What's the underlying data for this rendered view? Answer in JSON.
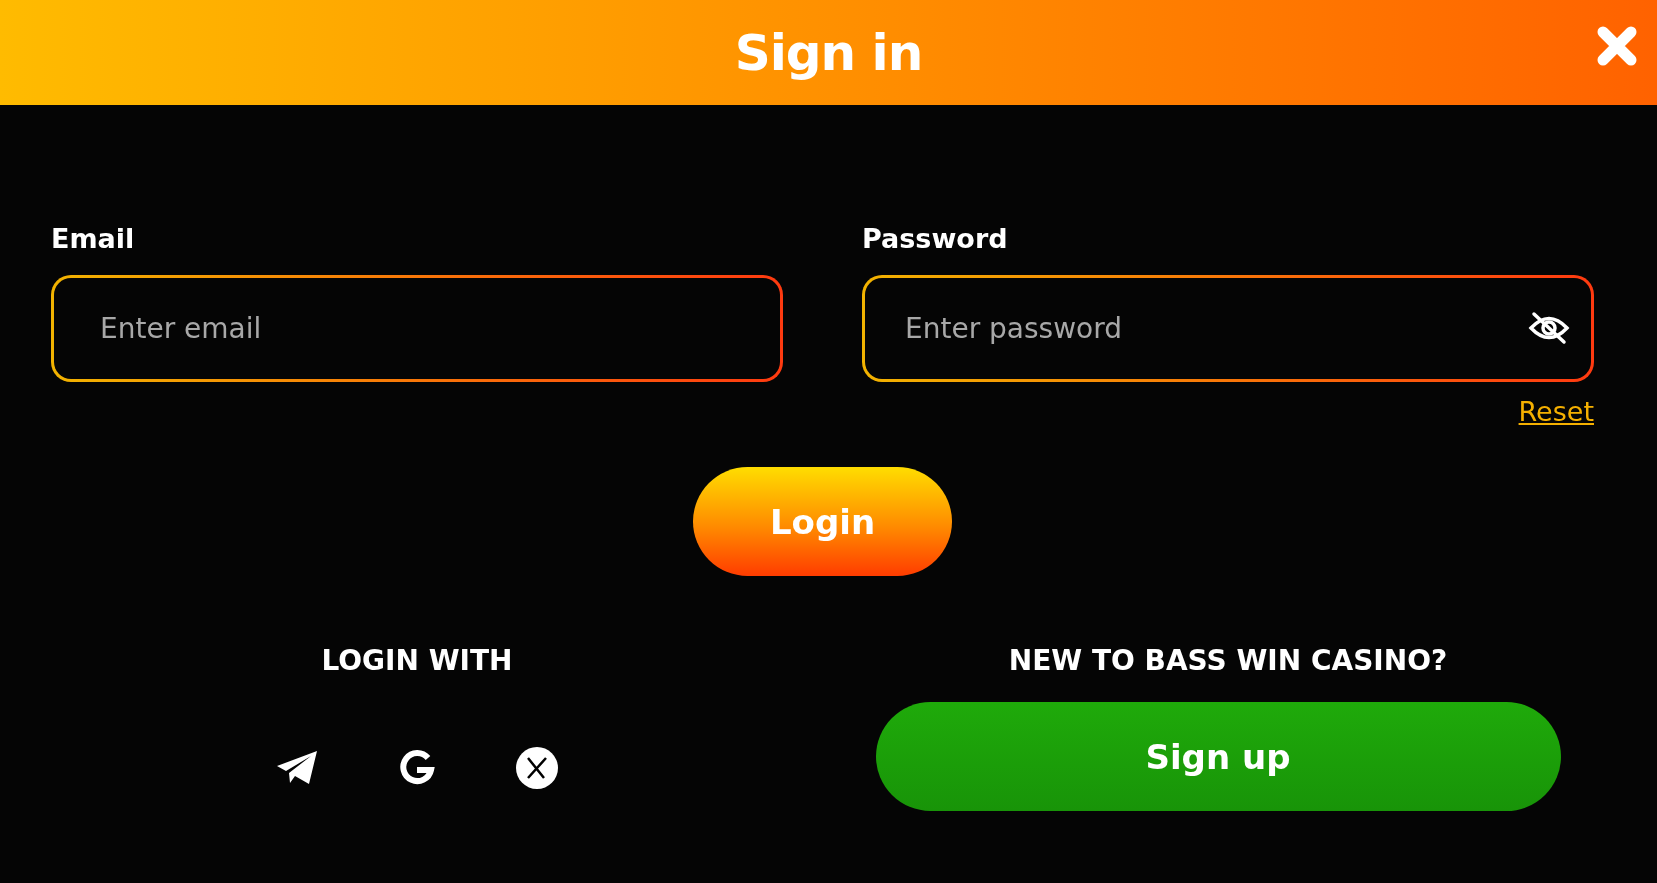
{
  "window": {
    "title": "Sign in"
  },
  "fields": [
    {
      "kind": "email",
      "label": "Email",
      "placeholder": "Enter email"
    },
    {
      "kind": "password",
      "label": "Password",
      "placeholder": "Enter password",
      "hidden": true
    }
  ],
  "reset_link": "Reset",
  "login_button": "Login",
  "social": {
    "title": "LOGIN WITH",
    "providers": [
      {
        "kind": "telegram"
      },
      {
        "kind": "google"
      },
      {
        "kind": "x"
      }
    ]
  },
  "signup": {
    "title": "NEW TO BASS WIN CASINO?",
    "button": "Sign up"
  }
}
